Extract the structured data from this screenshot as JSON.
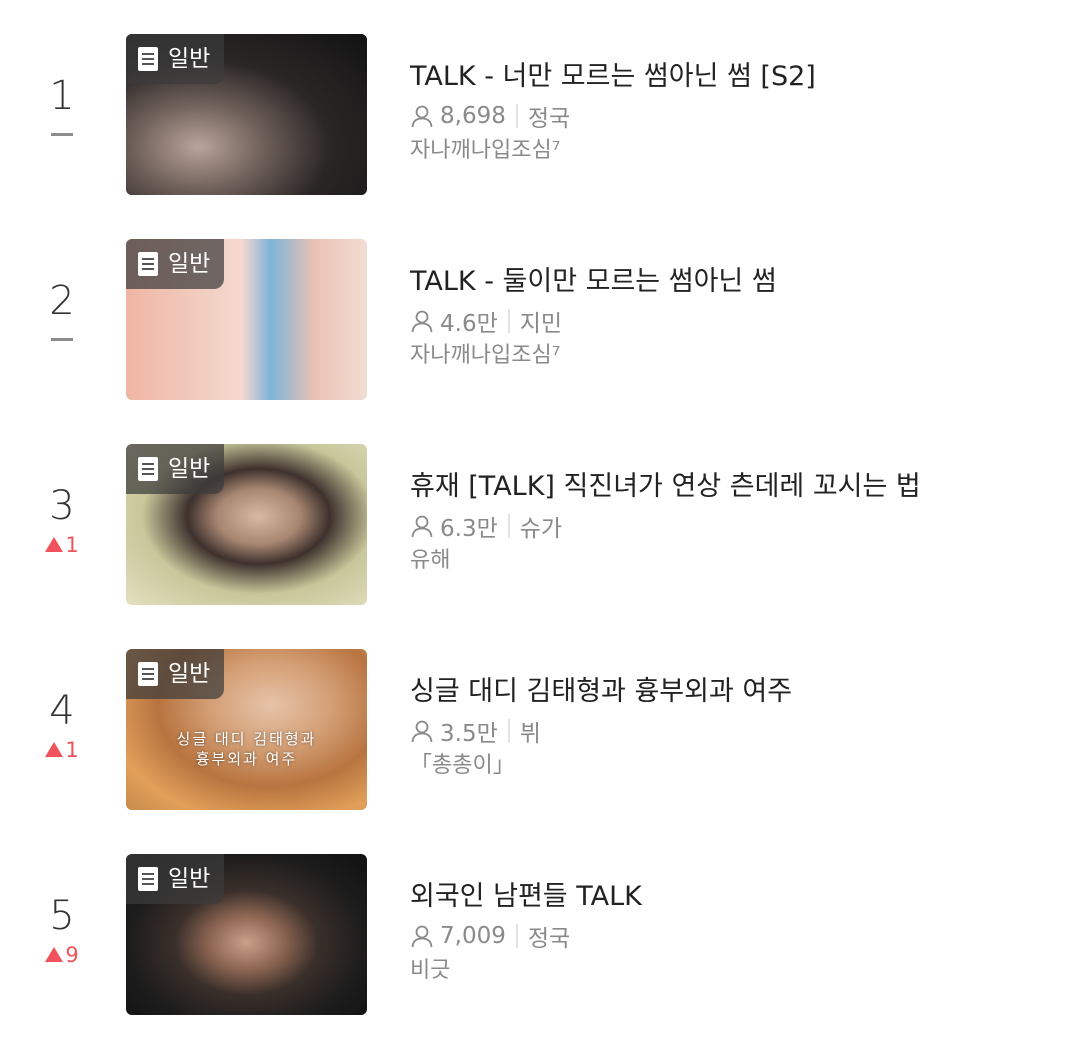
{
  "badge_label": "일반",
  "colors": {
    "rank_up": "#f0535b",
    "meta_text": "#8a8a8a",
    "title_text": "#222222"
  },
  "items": [
    {
      "rank": "1",
      "change": "flat",
      "change_value": "",
      "title": "TALK  - 너만 모르는 썸아닌 썸 [S2]",
      "views": "8,698",
      "character": "정국",
      "author": "자나깨나입조심⁷",
      "thumb_overlay": ""
    },
    {
      "rank": "2",
      "change": "flat",
      "change_value": "",
      "title": "TALK - 둘이만 모르는 썸아닌 썸",
      "views": "4.6만",
      "character": "지민",
      "author": "자나깨나입조심⁷",
      "thumb_overlay": ""
    },
    {
      "rank": "3",
      "change": "up",
      "change_value": "1",
      "title": "휴재 [TALK] 직진녀가 연상 츤데레 꼬시는 법",
      "views": "6.3만",
      "character": "슈가",
      "author": "유해",
      "thumb_overlay": ""
    },
    {
      "rank": "4",
      "change": "up",
      "change_value": "1",
      "title": "싱글 대디 김태형과 흉부외과 여주",
      "views": "3.5만",
      "character": "뷔",
      "author": "「총총이」",
      "thumb_overlay": "싱글 대디 김태형과\n흉부외과 여주"
    },
    {
      "rank": "5",
      "change": "up",
      "change_value": "9",
      "title": "외국인 남편들 TALK",
      "views": "7,009",
      "character": "정국",
      "author": "비긋",
      "thumb_overlay": ""
    }
  ]
}
